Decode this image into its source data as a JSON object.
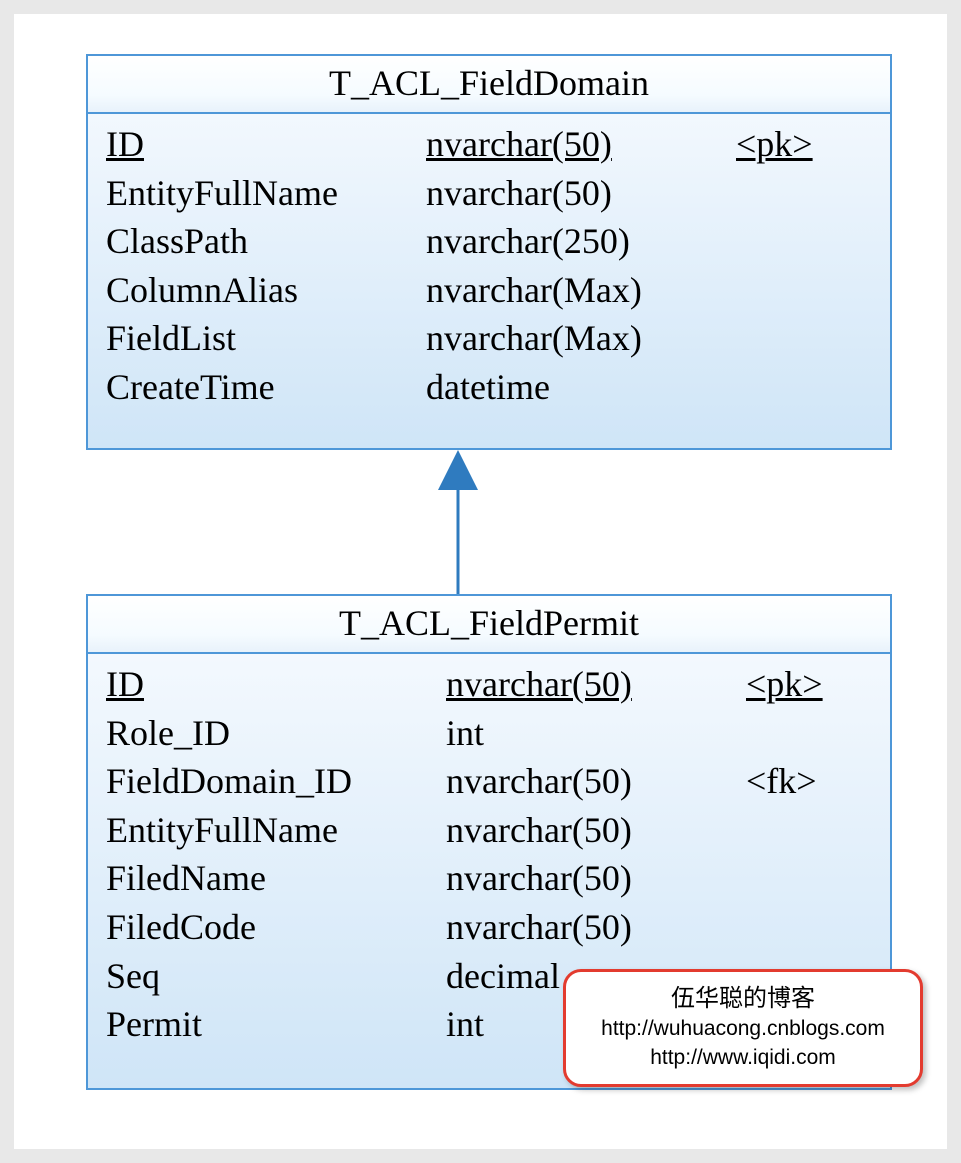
{
  "entity1": {
    "title": "T_ACL_FieldDomain",
    "rows": [
      {
        "name": "ID",
        "type": "nvarchar(50)",
        "key": "<pk>",
        "pk": true
      },
      {
        "name": "EntityFullName",
        "type": "nvarchar(50)",
        "key": "",
        "pk": false
      },
      {
        "name": "ClassPath",
        "type": "nvarchar(250)",
        "key": "",
        "pk": false
      },
      {
        "name": "ColumnAlias",
        "type": "nvarchar(Max)",
        "key": "",
        "pk": false
      },
      {
        "name": "FieldList",
        "type": "nvarchar(Max)",
        "key": "",
        "pk": false
      },
      {
        "name": "CreateTime",
        "type": "datetime",
        "key": "",
        "pk": false
      }
    ]
  },
  "entity2": {
    "title": "T_ACL_FieldPermit",
    "rows": [
      {
        "name": "ID",
        "type": "nvarchar(50)",
        "key": "<pk>",
        "pk": true
      },
      {
        "name": "Role_ID",
        "type": "int",
        "key": "",
        "pk": false
      },
      {
        "name": "FieldDomain_ID",
        "type": "nvarchar(50)",
        "key": "<fk>",
        "pk": false
      },
      {
        "name": "EntityFullName",
        "type": "nvarchar(50)",
        "key": "",
        "pk": false
      },
      {
        "name": "FiledName",
        "type": "nvarchar(50)",
        "key": "",
        "pk": false
      },
      {
        "name": "FiledCode",
        "type": "nvarchar(50)",
        "key": "",
        "pk": false
      },
      {
        "name": "Seq",
        "type": "decimal",
        "key": "",
        "pk": false
      },
      {
        "name": "Permit",
        "type": "int",
        "key": "",
        "pk": false
      }
    ]
  },
  "watermark": {
    "title": "伍华聪的博客",
    "line1": "http://wuhuacong.cnblogs.com",
    "line2": "http://www.iqidi.com"
  }
}
